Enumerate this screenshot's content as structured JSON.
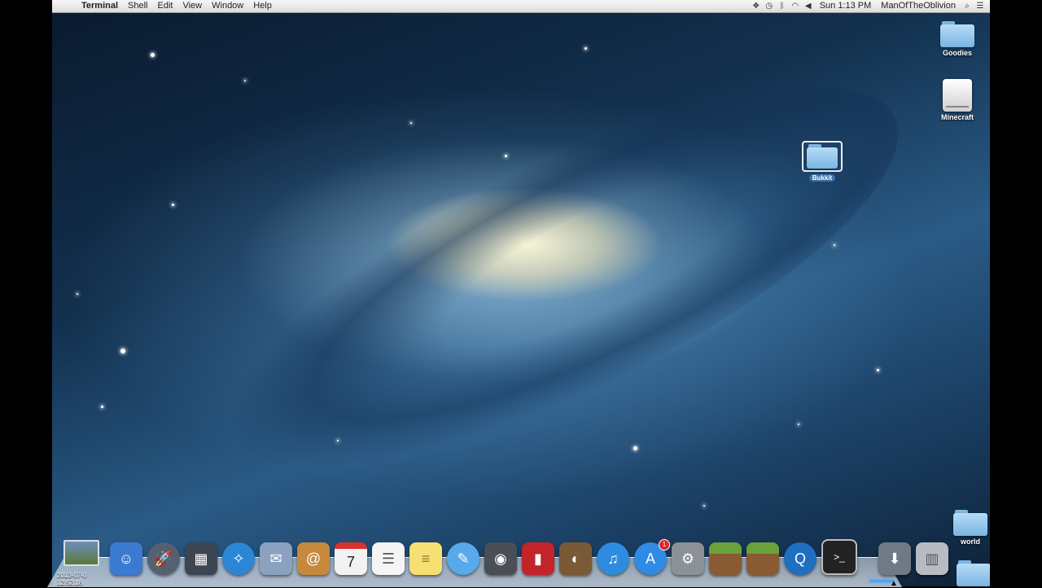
{
  "menubar": {
    "apple_glyph": "",
    "app_name": "Terminal",
    "menus": [
      "Shell",
      "Edit",
      "View",
      "Window",
      "Help"
    ],
    "status_icons": [
      "dropbox-icon",
      "time-machine-icon",
      "bluetooth-icon",
      "wifi-icon",
      "volume-icon"
    ],
    "clock": "Sun 1:13 PM",
    "user": "ManOfTheOblivion"
  },
  "desktop_icons": [
    {
      "label": "Goodies",
      "type": "folder"
    },
    {
      "label": "Minecraft",
      "type": "drive"
    },
    {
      "label": "Bukkit",
      "type": "folder",
      "selected": true
    },
    {
      "label": "world",
      "type": "folder"
    }
  ],
  "screenshot_thumb": {
    "label_line1": "2013-07-0",
    "label_line2": "12.52.18"
  },
  "dock": {
    "apps": [
      {
        "name": "finder-icon",
        "glyph": "☺",
        "color": "#3a7ad1"
      },
      {
        "name": "launchpad-icon",
        "glyph": "🚀",
        "color": "#556070"
      },
      {
        "name": "mission-control-icon",
        "glyph": "▦",
        "color": "#3b4652"
      },
      {
        "name": "safari-icon",
        "glyph": "✧",
        "color": "#2b86d6"
      },
      {
        "name": "mail-icon",
        "glyph": "✉",
        "color": "#8aa2bf"
      },
      {
        "name": "contacts-icon",
        "glyph": "@",
        "color": "#c58a3c"
      },
      {
        "name": "calendar-icon",
        "glyph": "7",
        "color": "#f2f2f2"
      },
      {
        "name": "reminders-icon",
        "glyph": "☰",
        "color": "#f5f5f5"
      },
      {
        "name": "notes-icon",
        "glyph": "≡",
        "color": "#f6df73"
      },
      {
        "name": "messages-icon",
        "glyph": "💬",
        "color": "#58a9ea"
      },
      {
        "name": "facetime-icon",
        "glyph": "◉",
        "color": "#4a4f57"
      },
      {
        "name": "photo-booth-icon",
        "glyph": "▮",
        "color": "#c3242a"
      },
      {
        "name": "iphoto-icon",
        "glyph": "◐",
        "color": "#7a5a36"
      },
      {
        "name": "itunes-icon",
        "glyph": "♫",
        "color": "#2e8ce0"
      },
      {
        "name": "app-store-icon",
        "glyph": "A",
        "color": "#2f8be3",
        "badge": "1"
      },
      {
        "name": "system-preferences-icon",
        "glyph": "⚙",
        "color": "#8c9199"
      },
      {
        "name": "minecraft-icon",
        "glyph": "■",
        "color": "#5f8f33"
      },
      {
        "name": "minecraft-server-icon",
        "glyph": "■",
        "color": "#5f8f33"
      },
      {
        "name": "quicktime-icon",
        "glyph": "Q",
        "color": "#1f6fc0"
      },
      {
        "name": "terminal-icon",
        "glyph": ">_",
        "color": "#222"
      }
    ],
    "right": [
      {
        "name": "downloads-stack-icon",
        "glyph": "⬇",
        "color": "#707a86"
      },
      {
        "name": "trash-icon",
        "glyph": "🗑",
        "color": "#b8bcc2"
      }
    ]
  }
}
